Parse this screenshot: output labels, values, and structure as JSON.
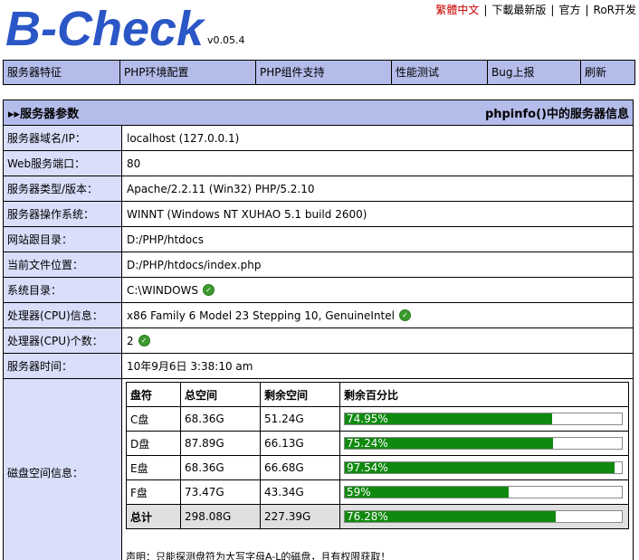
{
  "header": {
    "logo": "B-Check",
    "version": "v0.05.4",
    "links": [
      {
        "label": "繁體中文"
      },
      {
        "label": "下載最新版"
      },
      {
        "label": "官方"
      },
      {
        "label": "RoR开发"
      }
    ]
  },
  "nav": {
    "items": [
      {
        "label": "服务器特征"
      },
      {
        "label": "PHP环境配置"
      },
      {
        "label": "PHP组件支持"
      },
      {
        "label": "性能测试"
      },
      {
        "label": "Bug上报"
      },
      {
        "label": "刷新"
      }
    ]
  },
  "panel": {
    "title": "服务器参数",
    "right_title": "phpinfo()中的服务器信息",
    "rows": [
      {
        "label": "服务器域名/IP：",
        "value": "localhost (127.0.0.1)"
      },
      {
        "label": "Web服务端口：",
        "value": "80"
      },
      {
        "label": "服务器类型/版本：",
        "value": "Apache/2.2.11 (Win32) PHP/5.2.10"
      },
      {
        "label": "服务器操作系统：",
        "value": "WINNT (Windows NT XUHAO 5.1 build 2600)"
      },
      {
        "label": "网站跟目录：",
        "value": "D:/PHP/htdocs"
      },
      {
        "label": "当前文件位置：",
        "value": "D:/PHP/htdocs/index.php"
      },
      {
        "label": "系统目录：",
        "value": "C:\\WINDOWS"
      },
      {
        "label": "处理器(CPU)信息：",
        "value": "x86 Family 6 Model 23 Stepping 10, GenuineIntel"
      },
      {
        "label": "处理器(CPU)个数：",
        "value": "2"
      },
      {
        "label": "服务器时间：",
        "value": "10年9月6日  3:38:10 am"
      }
    ],
    "disk": {
      "label": "磁盘空间信息：",
      "headers": [
        "盘符",
        "总空间",
        "剩余空间",
        "剩余百分比"
      ],
      "rows": [
        {
          "drive": "C盘",
          "total": "68.36G",
          "free": "51.24G",
          "percent": "74.95%",
          "fraction": 0.7495
        },
        {
          "drive": "D盘",
          "total": "87.89G",
          "free": "66.13G",
          "percent": "75.24%",
          "fraction": 0.7524
        },
        {
          "drive": "E盘",
          "total": "68.36G",
          "free": "66.68G",
          "percent": "97.54%",
          "fraction": 0.9754
        },
        {
          "drive": "F盘",
          "total": "73.47G",
          "free": "43.34G",
          "percent": "59%",
          "fraction": 0.59
        }
      ],
      "total": {
        "drive": "总计",
        "total": "298.08G",
        "free": "227.39G",
        "percent": "76.28%",
        "fraction": 0.7628
      },
      "note": "声明：只能探测盘符为大写字母A-L的磁盘，且有权限获取！"
    }
  },
  "colors": {
    "accent": "#2a56c6",
    "nav_bg": "#b4bcea",
    "label_bg": "#d9defa",
    "bar_fill": "#0f8a0f"
  }
}
